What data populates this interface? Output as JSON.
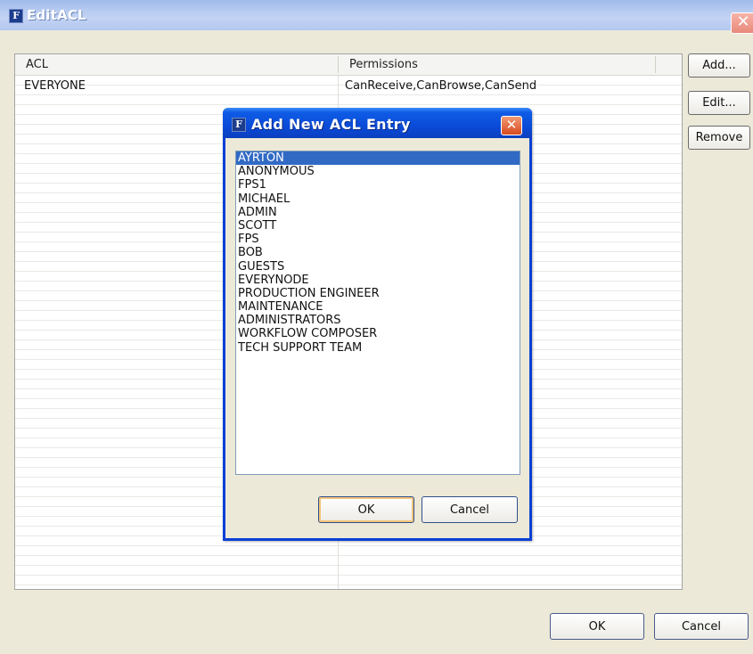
{
  "window": {
    "title": "EditACL",
    "icon_glyph": "F",
    "close_glyph": "✕"
  },
  "acl_table": {
    "columns": [
      "ACL",
      "Permissions"
    ],
    "rows": [
      {
        "acl": "EVERYONE",
        "permissions": "CanReceive,CanBrowse,CanSend"
      }
    ]
  },
  "side_buttons": {
    "add": "Add...",
    "edit": "Edit...",
    "remove": "Remove"
  },
  "bottom_buttons": {
    "ok": "OK",
    "cancel": "Cancel"
  },
  "dialog": {
    "title": "Add New ACL Entry",
    "icon_glyph": "F",
    "close_glyph": "✕",
    "items": [
      "AYRTON",
      "ANONYMOUS",
      "FPS1",
      "MICHAEL",
      "ADMIN",
      "SCOTT",
      "FPS",
      "BOB",
      "GUESTS",
      "EVERYNODE",
      "PRODUCTION ENGINEER",
      "MAINTENANCE",
      "ADMINISTRATORS",
      "WORKFLOW COMPOSER",
      "TECH SUPPORT TEAM"
    ],
    "selected_item": "AYRTON",
    "ok": "OK",
    "cancel": "Cancel"
  },
  "colors": {
    "selection": "#316ac5",
    "dialog_title": "#0a4bd8",
    "window_face": "#ece9d8"
  }
}
